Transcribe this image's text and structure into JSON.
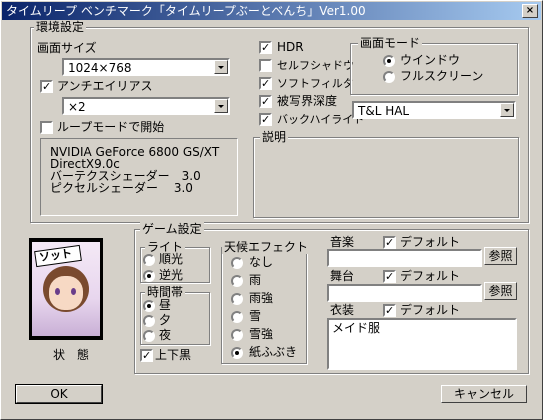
{
  "window": {
    "title": "タイムリープ ベンチマーク「タイムリープぶーとべんち」Ver1.00",
    "close": "×"
  },
  "env": {
    "legend": "環境設定",
    "screen_size_label": "画面サイズ",
    "screen_size_value": "1024×768",
    "antialias_label": "アンチエイリアス",
    "antialias_checked": true,
    "antialias_value": "×2",
    "loop_label": "ループモードで開始",
    "loop_checked": false,
    "options": [
      {
        "label": "HDR",
        "checked": true
      },
      {
        "label": "セルフシャドウ",
        "checked": false
      },
      {
        "label": "ソフトフィルタ",
        "checked": true
      },
      {
        "label": "被写界深度",
        "checked": true
      },
      {
        "label": "バックハイライト",
        "checked": true
      }
    ],
    "screen_mode": {
      "legend": "画面モード",
      "window_label": "ウインドウ",
      "full_label": "フルスクリーン",
      "selected": "window"
    },
    "hal_value": "T&L HAL",
    "info_lines": [
      "NVIDIA GeForce 6800 GS/XT",
      "DirectX9.0c",
      "バーテクスシェーダー　3.0",
      "ピクセルシェーダー　 3.0"
    ],
    "desc_legend": "説明"
  },
  "status_label": "状　態",
  "game": {
    "legend": "ゲーム設定",
    "light": {
      "legend": "ライト",
      "options": [
        "順光",
        "逆光"
      ],
      "selected": 1
    },
    "time": {
      "legend": "時間帯",
      "options": [
        "昼",
        "夕",
        "夜"
      ],
      "selected": 0
    },
    "letterbox_label": "上下黒",
    "letterbox_checked": true,
    "weather": {
      "legend": "天候エフェクト",
      "options": [
        "なし",
        "雨",
        "雨強",
        "雪",
        "雪強",
        "紙ふぶき"
      ],
      "selected": 5
    },
    "music_label": "音楽",
    "stage_label": "舞台",
    "costume_label": "衣装",
    "default_label": "デフォルト",
    "browse_label": "参照",
    "costume_value": "メイド服"
  },
  "buttons": {
    "ok": "OK",
    "cancel": "キャンセル"
  },
  "preview_text": "ソット"
}
